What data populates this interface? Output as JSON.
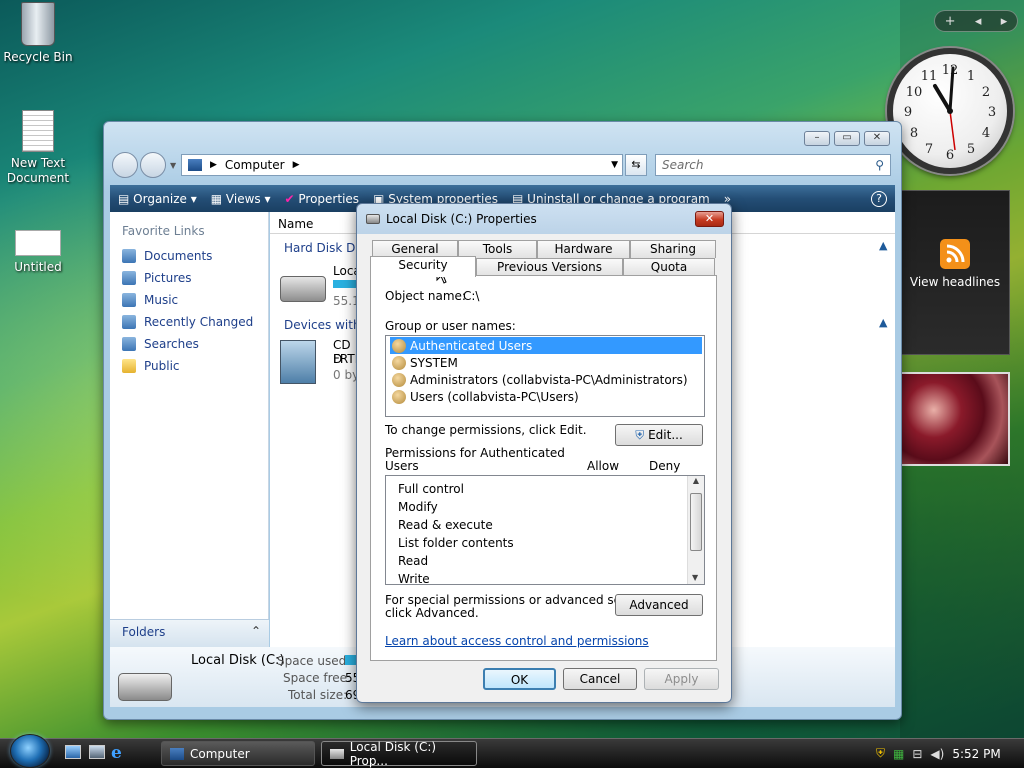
{
  "desktop": {
    "icons": [
      {
        "label": "Recycle Bin"
      },
      {
        "label": "New Text Document"
      },
      {
        "label": "Untitled"
      }
    ]
  },
  "sidebar": {
    "controls": [
      "+",
      "◂",
      "▸"
    ],
    "feed_label": "View headlines",
    "clock_numbers": [
      "12",
      "1",
      "2",
      "3",
      "4",
      "5",
      "6",
      "7",
      "8",
      "9",
      "10",
      "11"
    ]
  },
  "explorer": {
    "address": "Computer",
    "search_placeholder": "Search",
    "toolbar": [
      "Organize",
      "Views",
      "Properties",
      "System properties",
      "Uninstall or change a program",
      "»"
    ],
    "nav_header": "Favorite Links",
    "nav_links": [
      "Documents",
      "Pictures",
      "Music",
      "Recently Changed",
      "Searches",
      "Public"
    ],
    "folders_label": "Folders",
    "column_name": "Name",
    "group_hard_disk": "Hard Disk Driv",
    "drive_label": "Loca",
    "drive_size": "55.1",
    "group_devices": "Devices with R",
    "cd_line1": "CD D",
    "cd_line2": "FRTN",
    "cd_line3": "0 by",
    "details": {
      "name": "Local Disk (C:)",
      "space_used_label": "Space used:",
      "space_free_label": "Space free:",
      "space_free_value": "55",
      "total_size_label": "Total size:",
      "total_size_value": "69"
    }
  },
  "dialog": {
    "title": "Local Disk (C:) Properties",
    "tabs_row1": [
      "General",
      "Tools",
      "Hardware",
      "Sharing"
    ],
    "tabs_row2": [
      "Security",
      "Previous Versions",
      "Quota"
    ],
    "object_name_label": "Object name:",
    "object_name_value": "C:\\",
    "group_label": "Group or user names:",
    "users": [
      "Authenticated Users",
      "SYSTEM",
      "Administrators (collabvista-PC\\Administrators)",
      "Users (collabvista-PC\\Users)"
    ],
    "change_text": "To change permissions, click Edit.",
    "edit_button": "Edit...",
    "perm_for_line1": "Permissions for Authenticated",
    "perm_for_line2": "Users",
    "allow_label": "Allow",
    "deny_label": "Deny",
    "permissions": [
      "Full control",
      "Modify",
      "Read & execute",
      "List folder contents",
      "Read",
      "Write"
    ],
    "special_line1": "For special permissions or advanced settings,",
    "special_line2": "click Advanced.",
    "advanced_button": "Advanced",
    "learn_link": "Learn about access control and permissions",
    "ok": "OK",
    "cancel": "Cancel",
    "apply": "Apply"
  },
  "taskbar": {
    "tasks": [
      "Computer",
      "Local Disk (C:) Prop..."
    ],
    "time": "5:52 PM"
  }
}
